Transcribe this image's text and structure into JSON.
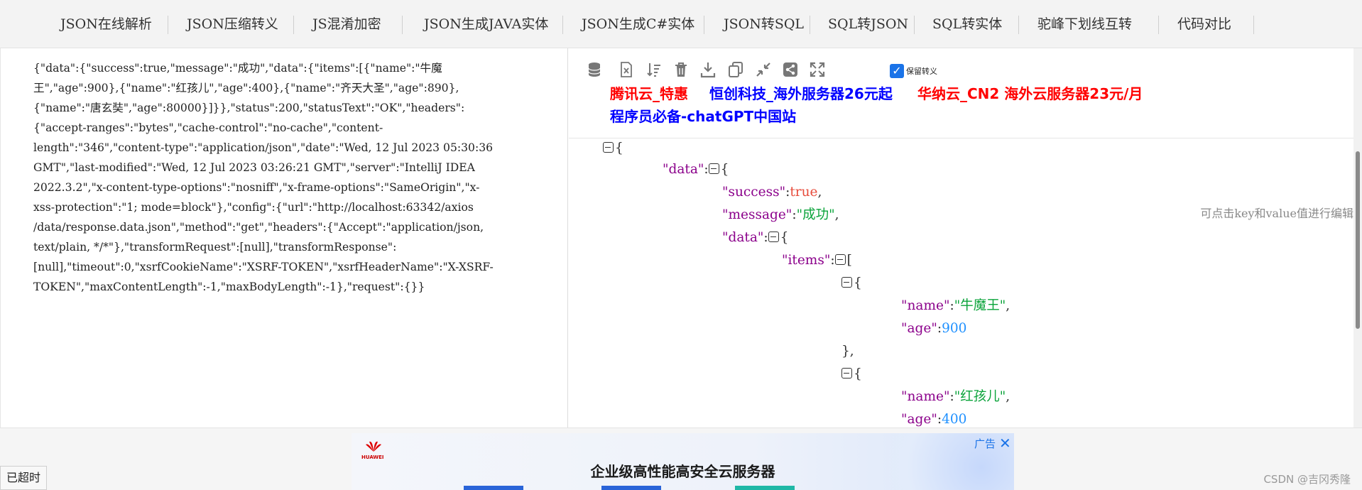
{
  "nav": {
    "items": [
      "JSON在线解析",
      "JSON压缩转义",
      "JS混淆加密",
      "JSON生成JAVA实体",
      "JSON生成C#实体",
      "JSON转SQL",
      "SQL转JSON",
      "SQL转实体",
      "驼峰下划线互转",
      "代码对比"
    ]
  },
  "left": {
    "raw_lines": [
      "{\"data\":{\"success\":true,\"message\":\"成功\",\"data\":{\"items\":[{\"name\":\"牛魔",
      "王\",\"age\":900},{\"name\":\"红孩儿\",\"age\":400},{\"name\":\"齐天大圣\",\"age\":890},",
      "{\"name\":\"唐玄奘\",\"age\":80000}]}},\"status\":200,\"statusText\":\"OK\",\"headers\":",
      "{\"accept-ranges\":\"bytes\",\"cache-control\":\"no-cache\",\"content-",
      "length\":\"346\",\"content-type\":\"application/json\",\"date\":\"Wed, 12 Jul 2023 05:30:36",
      "GMT\",\"last-modified\":\"Wed, 12 Jul 2023 03:26:21 GMT\",\"server\":\"IntelliJ IDEA",
      "2022.3.2\",\"x-content-type-options\":\"nosniff\",\"x-frame-options\":\"SameOrigin\",\"x-",
      "xss-protection\":\"1; mode=block\"},\"config\":{\"url\":\"http://localhost:63342/axios",
      "/data/response.data.json\",\"method\":\"get\",\"headers\":{\"Accept\":\"application/json,",
      "text/plain, */*\"},\"transformRequest\":[null],\"transformResponse\":",
      "[null],\"timeout\":0,\"xsrfCookieName\":\"XSRF-TOKEN\",\"xsrfHeaderName\":\"X-XSRF-",
      "TOKEN\",\"maxContentLength\":-1,\"maxBodyLength\":-1},\"request\":{}}"
    ]
  },
  "toolbar": {
    "icons": [
      "database-icon",
      "excel-export-icon",
      "sort-icon",
      "delete-icon",
      "download-icon",
      "copy-icon",
      "compress-icon",
      "share-icon",
      "fullscreen-icon"
    ],
    "keep_escape_label": "保留转义"
  },
  "ads": {
    "tencent": "腾讯云_特惠",
    "hengchuang": "恒创科技_海外服务器26元起",
    "huana": "华纳云_CN2 海外云服务器23元/月",
    "chatgpt": "程序员必备-chatGPT中国站"
  },
  "colors": {
    "ad_red": "#ff0000",
    "ad_blue": "#0000ff",
    "key": "#8b008b",
    "string": "#0aa33a",
    "number": "#1e90ff",
    "bool": "#e74c3c",
    "accent": "#1a73e8"
  },
  "tree": {
    "key_data_outer": "\"data\"",
    "key_success": "\"success\"",
    "val_success": "true",
    "key_message": "\"message\"",
    "val_message": "\"成功\"",
    "key_data_inner": "\"data\"",
    "key_items": "\"items\"",
    "key_name_1": "\"name\"",
    "val_name_1": "\"牛魔王\"",
    "key_age_1": "\"age\"",
    "val_age_1": "900",
    "key_name_2": "\"name\"",
    "val_name_2": "\"红孩儿\"",
    "key_age_2": "\"age\"",
    "val_age_2": "400"
  },
  "hint": "可点击key和value值进行编辑",
  "banner": {
    "brand": "HUAWEI",
    "headline": "企业级高性能高安全云服务器",
    "ad_label": "广告",
    "close": "✕"
  },
  "status": "已超时",
  "watermark": "CSDN @吉冈秀隆"
}
